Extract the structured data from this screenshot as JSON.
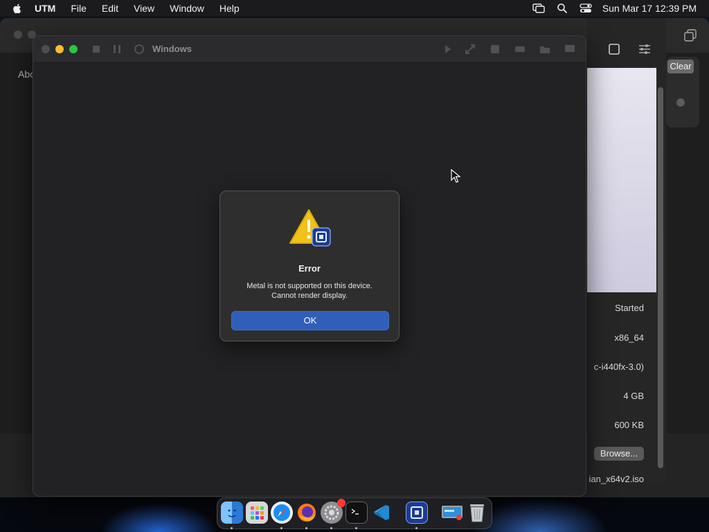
{
  "menubar": {
    "app_name": "UTM",
    "items": [
      "File",
      "Edit",
      "View",
      "Window",
      "Help"
    ],
    "clock": "Sun Mar 17  12:39 PM"
  },
  "background_window": {
    "sidebar_label": "Abo",
    "search_panel": {
      "clear_label": "Clear"
    },
    "vm_details": {
      "status": "Started",
      "architecture": "x86_64",
      "machine": "c-i440fx-3.0)",
      "memory": "4 GB",
      "size": "600 KB",
      "browse_label": "Browse...",
      "iso": "ian_x64v2.iso"
    }
  },
  "vm_window": {
    "title": "Windows"
  },
  "dialog": {
    "title": "Error",
    "message_line1": "Metal is not supported on this device.",
    "message_line2": "Cannot render display.",
    "ok_label": "OK"
  },
  "dock": {
    "apps": [
      "finder-icon",
      "launchpad-icon",
      "safari-icon",
      "firefox-icon",
      "system-settings-icon",
      "terminal-icon",
      "vscode-icon",
      "utm-icon",
      "screen-sharing-icon",
      "trash-icon"
    ]
  },
  "colors": {
    "accent": "#2f5fb8",
    "traffic_min": "#febc2e",
    "traffic_max": "#28c840",
    "warning": "#f2c21a"
  }
}
